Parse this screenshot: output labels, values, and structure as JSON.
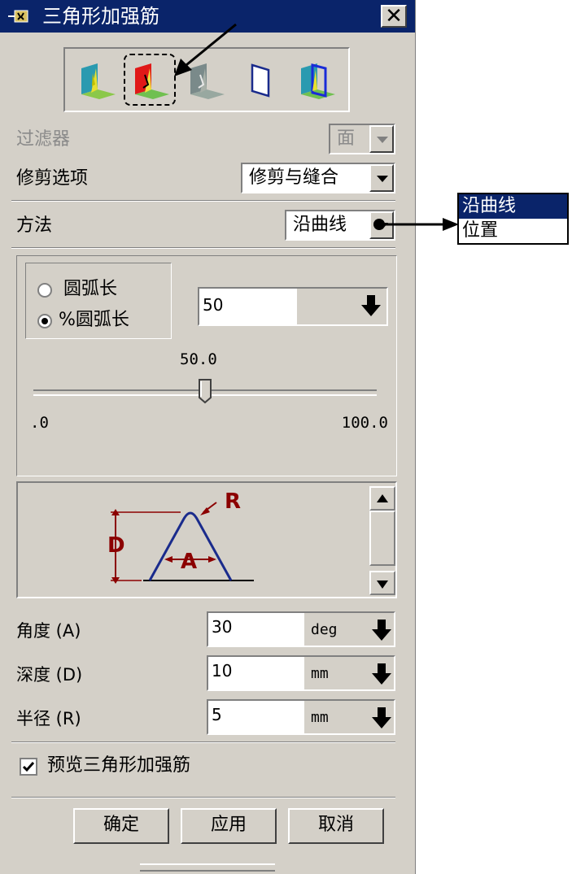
{
  "window": {
    "title": "三角形加强筋",
    "close_symbol": "✕"
  },
  "toolbar": {
    "tools": [
      {
        "icon": "rib-face-icon"
      },
      {
        "icon": "rib-selected-face-icon",
        "selected": true
      },
      {
        "icon": "rib-disabled-icon"
      },
      {
        "icon": "plane-outline-icon"
      },
      {
        "icon": "rib-plane-icon"
      }
    ]
  },
  "filter": {
    "label": "过滤器",
    "value": "面",
    "disabled": true
  },
  "trim": {
    "label": "修剪选项",
    "value": "修剪与缝合"
  },
  "method": {
    "label": "方法",
    "value": "沿曲线",
    "options": [
      "沿曲线",
      "位置"
    ],
    "highlighted_option": "沿曲线"
  },
  "position": {
    "arc_length_label": "圆弧长",
    "percent_arc_length_label": "%圆弧长",
    "selected": "percent_arc_length",
    "value": "50",
    "slider_value": "50.0",
    "slider_min": ".0",
    "slider_max": "100.0",
    "slider_fraction": 0.5
  },
  "diagram": {
    "label_r": "R",
    "label_d": "D",
    "label_a": "A"
  },
  "params": [
    {
      "label": "角度 (A)",
      "value": "30",
      "unit": "deg"
    },
    {
      "label": "深度 (D)",
      "value": "10",
      "unit": "mm"
    },
    {
      "label": "半径 (R)",
      "value": "5",
      "unit": "mm"
    }
  ],
  "preview": {
    "label": "预览三角形加强筋",
    "checked": true
  },
  "buttons": {
    "ok": "确定",
    "apply": "应用",
    "cancel": "取消"
  },
  "colors": {
    "title_bar": "#0a246a",
    "dialog_bg": "#d4d0c8",
    "diagram_line": "#1a2b8c",
    "diagram_label": "#8b0000",
    "highlight": "#0a246a"
  }
}
